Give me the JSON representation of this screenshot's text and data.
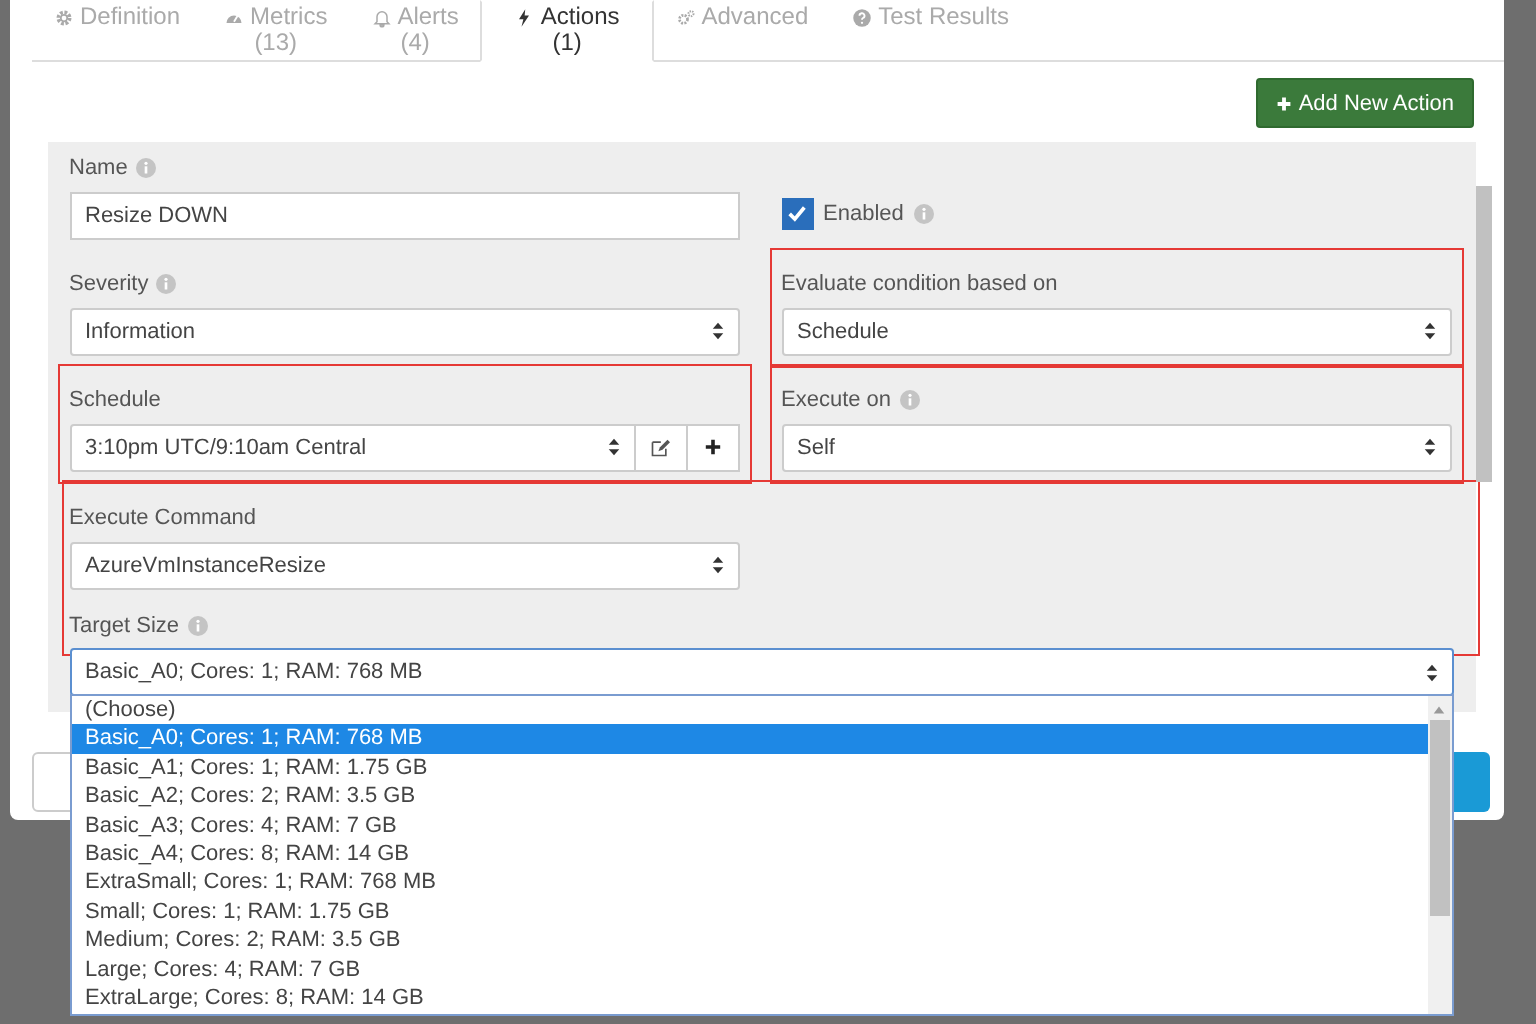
{
  "tabs": [
    {
      "label": "Definition",
      "selected": false
    },
    {
      "label": "Metrics",
      "count": "(13)",
      "selected": false
    },
    {
      "label": "Alerts",
      "count": "(4)",
      "selected": false
    },
    {
      "label": "Actions",
      "count": "(1)",
      "selected": true
    },
    {
      "label": "Advanced",
      "selected": false
    },
    {
      "label": "Test Results",
      "selected": false
    }
  ],
  "add_button": "Add New Action",
  "rows": [
    {
      "fields": [
        {
          "kind": "text",
          "label": "Name",
          "info": true,
          "value": "Resize DOWN",
          "highlighted": false
        },
        {
          "kind": "checkbox",
          "label": "Enabled",
          "info": true,
          "checked": true,
          "highlighted": false
        }
      ]
    },
    {
      "fields": [
        {
          "kind": "select",
          "label": "Severity",
          "info": true,
          "value": "Information",
          "highlighted": false
        },
        {
          "kind": "select",
          "label": "Evaluate condition based on",
          "info": false,
          "value": "Schedule",
          "highlighted": true
        }
      ]
    },
    {
      "fields": [
        {
          "kind": "select-buttons",
          "label": "Schedule",
          "info": false,
          "value": "3:10pm UTC/9:10am Central",
          "highlighted": true
        },
        {
          "kind": "select",
          "label": "Execute on",
          "info": true,
          "value": "Self",
          "highlighted": true
        }
      ]
    }
  ],
  "command_group": {
    "highlighted": true,
    "fields": [
      {
        "kind": "select",
        "label": "Execute Command",
        "info": false,
        "value": "AzureVmInstanceResize"
      },
      {
        "kind": "dropdown",
        "label": "Target Size",
        "info": true,
        "value": "Basic_A0; Cores: 1; RAM: 768 MB",
        "options": [
          {
            "label": "(Choose)",
            "selected": false
          },
          {
            "label": "Basic_A0; Cores: 1; RAM: 768 MB",
            "selected": true
          },
          {
            "label": "Basic_A1; Cores: 1; RAM: 1.75 GB",
            "selected": false
          },
          {
            "label": "Basic_A2; Cores: 2; RAM: 3.5 GB",
            "selected": false
          },
          {
            "label": "Basic_A3; Cores: 4; RAM: 7 GB",
            "selected": false
          },
          {
            "label": "Basic_A4; Cores: 8; RAM: 14 GB",
            "selected": false
          },
          {
            "label": "ExtraSmall; Cores: 1; RAM: 768 MB",
            "selected": false
          },
          {
            "label": "Small; Cores: 1; RAM: 1.75 GB",
            "selected": false
          },
          {
            "label": "Medium; Cores: 2; RAM: 3.5 GB",
            "selected": false
          },
          {
            "label": "Large; Cores: 4; RAM: 7 GB",
            "selected": false
          },
          {
            "label": "ExtraLarge; Cores: 8; RAM: 14 GB",
            "selected": false
          }
        ]
      }
    ]
  }
}
